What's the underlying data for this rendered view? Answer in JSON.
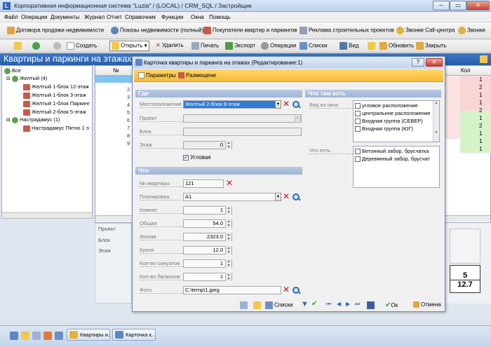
{
  "window": {
    "title": "Корпоративная информационная система \"Luzia\" / (LOCAL) / CRM_SQL / Застройщик",
    "app_icon": "L",
    "min": "─",
    "max": "▭",
    "close": "✕"
  },
  "menu": [
    "Файл",
    "Операции",
    "Документы",
    "Журнал",
    "Отчет",
    "Справочник",
    "Функции",
    "Окна",
    "Помощь"
  ],
  "toolbar1": [
    "Договора продажи недвижимости",
    "Показы недвижимости (полный)",
    "Покупатели квартир и паркингов",
    "Реклама строительных проектов",
    "Звонки Call-центра",
    "Звонки"
  ],
  "toolbar2": {
    "create": "Создать",
    "open": "Открыть",
    "delete": "Удалить",
    "print": "Печать",
    "export": "Экспорт",
    "operations": "Операции",
    "lists": "Списки",
    "view": "Вид",
    "refresh": "Обновить",
    "close": "Закрыть"
  },
  "section_title": "Квартиры и паркинги на этажах",
  "tree": {
    "root": "Все",
    "group1": "Желтый (4)",
    "items1": [
      "Желтый 1-блок 12-этаж",
      "Желтый 1-блок 3-этаж",
      "Желтый 1-блок Паркинг",
      "Желтый 2-блок 5-этаж"
    ],
    "group2": "Настрадамус (1)",
    "items2": [
      "Настрадамус Пятно 1 э"
    ]
  },
  "grid": {
    "col_no": "№",
    "col_kol": "Кол",
    "row_nums": [
      "2",
      "3",
      "4",
      "5",
      "6",
      "7",
      "8",
      "9"
    ],
    "kol": [
      "1",
      "2",
      "1",
      "1",
      "2",
      "1",
      "2",
      "1",
      "1",
      "1"
    ]
  },
  "lower_left": {
    "project": "Проект",
    "block": "Блок",
    "floor": "Этаж"
  },
  "scale_card": {
    "top": "5",
    "bottom": "12.7"
  },
  "dialog": {
    "title": "Карточка квартиры и паркинга на этажах (Редактирование:1)",
    "help": "?",
    "close": "✕",
    "tab_params": "Параметры",
    "tab_placement": "Размещени",
    "sec_where": "Где",
    "sec_what_is": "Что там есть",
    "sec_what": "Что",
    "location_label": "Местоположение",
    "location_value": "Желтый 2-блок 8-этаж",
    "project_label": "Проект",
    "project_value": "",
    "block_label": "Блок",
    "block_value": "",
    "floor_label": "Этаж",
    "floor_value": "0",
    "corner_label": "Угловая",
    "corner_checked": "✔",
    "view_label": "Вид из окна",
    "view_items": [
      "угловое расположение",
      "центральное расположение",
      "Входная группа (СЕВЕР)",
      "Входная группа (ЮГ)"
    ],
    "what_label": "Что есть",
    "what_items": [
      "Бетонный забор, брусчатка",
      "Деревянный забор, брусчат"
    ],
    "apt_no_label": "№ квартиры",
    "apt_no_value": "121",
    "layout_label": "Планировка",
    "layout_value": "A1",
    "rooms_label": "Комнат",
    "rooms_value": "1",
    "total_label": "Общая",
    "total_value": "54.0",
    "living_label": "Жилая",
    "living_value": "2323.0",
    "kitchen_label": "Кухня",
    "kitchen_value": "12.0",
    "bath_label": "Кол-во санузлов",
    "bath_value": "1",
    "balcony_label": "Кол-во балконов",
    "balcony_value": "1",
    "photo_label": "Фото",
    "photo_value": "C:\\temp\\1.jpeg",
    "btn_lists": "Списки",
    "btn_ok": "Ок",
    "btn_cancel": "Отмена"
  },
  "taskbar": [
    "Квартиры и..",
    "Карточка к.."
  ]
}
